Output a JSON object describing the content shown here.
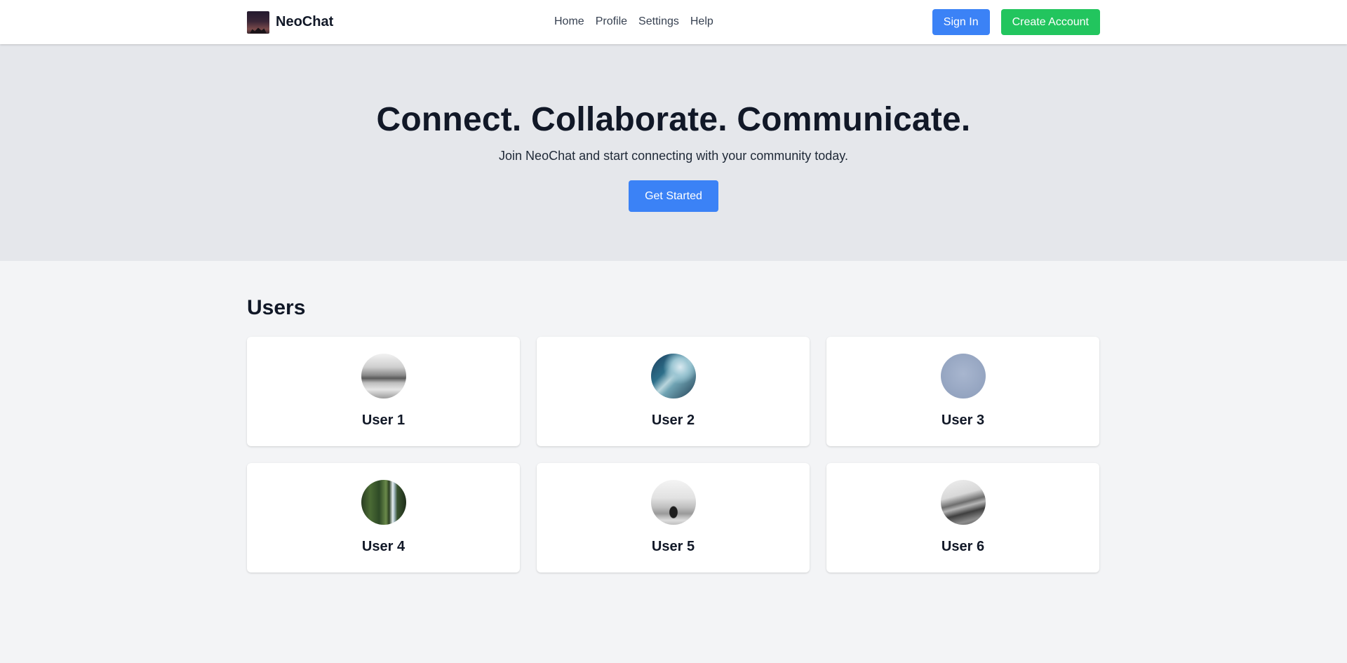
{
  "navbar": {
    "brand_name": "NeoChat",
    "logo": "neochat-logo-image",
    "links": [
      {
        "label": "Home"
      },
      {
        "label": "Profile"
      },
      {
        "label": "Settings"
      },
      {
        "label": "Help"
      }
    ],
    "sign_in_label": "Sign In",
    "create_account_label": "Create Account"
  },
  "hero": {
    "title": "Connect. Collaborate. Communicate.",
    "subtitle": "Join NeoChat and start connecting with your community today.",
    "cta_label": "Get Started"
  },
  "users": {
    "title": "Users",
    "items": [
      {
        "name": "User 1",
        "avatar": "grayscale-seascape-photo"
      },
      {
        "name": "User 2",
        "avatar": "aerial-coastline-photo"
      },
      {
        "name": "User 3",
        "avatar": "blue-gray-placeholder"
      },
      {
        "name": "User 4",
        "avatar": "forest-waterfall-photo"
      },
      {
        "name": "User 5",
        "avatar": "grayscale-rock-photo"
      },
      {
        "name": "User 6",
        "avatar": "grayscale-railway-photo"
      }
    ]
  },
  "colors": {
    "primary_blue": "#3b82f6",
    "success_green": "#22c55e",
    "hero_bg": "#e5e7eb",
    "page_bg": "#f3f4f6",
    "text_dark": "#111827"
  }
}
